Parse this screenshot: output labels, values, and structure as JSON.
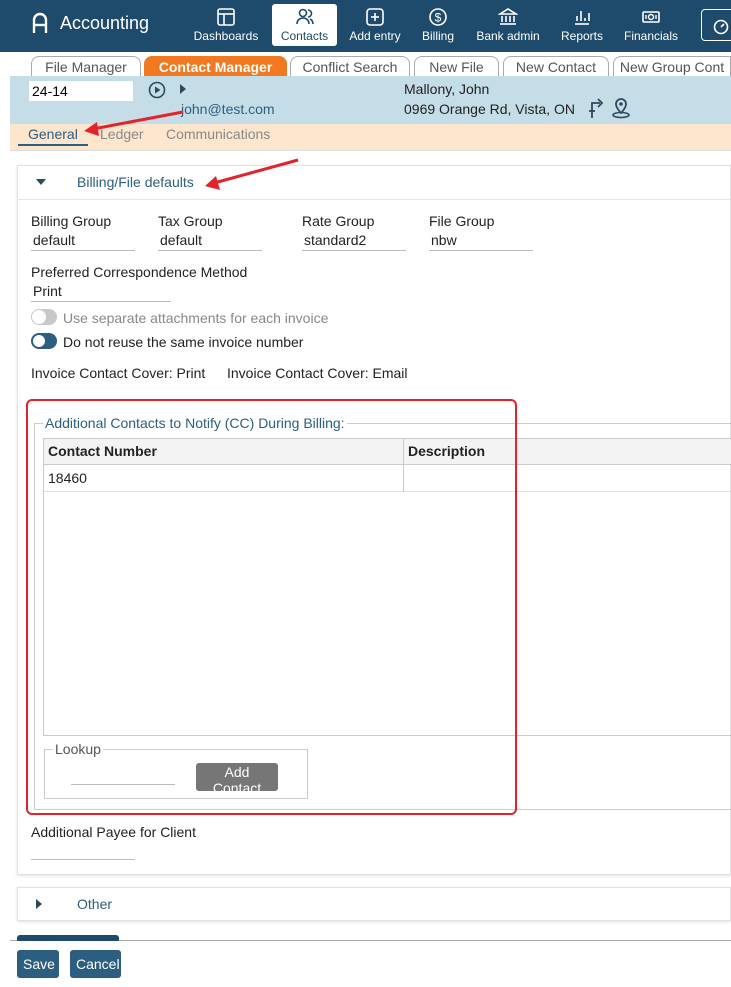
{
  "app": {
    "name": "Accounting"
  },
  "nav": {
    "items": [
      {
        "label": "Dashboards",
        "icon": "dashboard-icon"
      },
      {
        "label": "Contacts",
        "icon": "contacts-icon",
        "active": true
      },
      {
        "label": "Add entry",
        "icon": "add-entry-icon"
      },
      {
        "label": "Billing",
        "icon": "billing-icon"
      },
      {
        "label": "Bank admin",
        "icon": "bank-icon"
      },
      {
        "label": "Reports",
        "icon": "reports-icon"
      },
      {
        "label": "Financials",
        "icon": "financials-icon"
      }
    ]
  },
  "tabs": [
    {
      "label": "File Manager"
    },
    {
      "label": "Contact Manager",
      "active": true
    },
    {
      "label": "Conflict Search"
    },
    {
      "label": "New File"
    },
    {
      "label": "New Contact"
    },
    {
      "label": "New Group Cont"
    }
  ],
  "contact": {
    "file_number": "24-14",
    "email": "john@test.com",
    "name": "Mallony, John",
    "address": "0969 Orange Rd, Vista, ON"
  },
  "subtabs": [
    {
      "label": "General",
      "active": true
    },
    {
      "label": "Ledger"
    },
    {
      "label": "Communications"
    }
  ],
  "billing": {
    "title": "Billing/File defaults",
    "billing_group_label": "Billing Group",
    "billing_group_value": "default",
    "tax_group_label": "Tax Group",
    "tax_group_value": "default",
    "rate_group_label": "Rate Group",
    "rate_group_value": "standard2",
    "file_group_label": "File Group",
    "file_group_value": "nbw",
    "pref_corr_label": "Preferred Correspondence Method",
    "pref_corr_value": "Print",
    "separate_attachments_label": "Use separate attachments for each invoice",
    "separate_attachments_on": false,
    "no_reuse_label": "Do not reuse the same invoice number",
    "no_reuse_on": true,
    "invoice_cover_print": "Invoice Contact Cover: Print",
    "invoice_cover_email": "Invoice Contact Cover: Email",
    "cc_legend": "Additional Contacts to Notify (CC) During Billing:",
    "cc_columns": [
      "Contact Number",
      "Description"
    ],
    "cc_rows": [
      {
        "contact_number": "18460",
        "description": ""
      }
    ],
    "lookup_legend": "Lookup",
    "add_contact_label": "Add Contact",
    "payee_label": "Additional Payee for Client"
  },
  "other_section": {
    "title": "Other"
  },
  "footer": {
    "save_label": "Save",
    "cancel_label": "Cancel"
  },
  "colors": {
    "primary": "#1e4a6b",
    "accent": "#f07922",
    "link": "#2c5e7f",
    "annotation_red": "#e3232c"
  }
}
